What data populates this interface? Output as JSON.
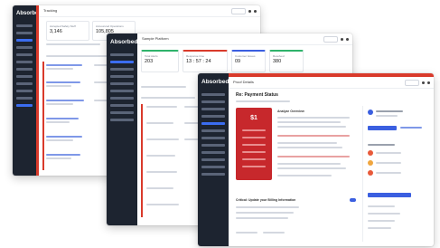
{
  "windows": {
    "back": {
      "title": "Tracking",
      "logo": "Absorbed",
      "cards": [
        {
          "label": "Accepted Safety Stuff",
          "value": "3,146"
        },
        {
          "label": "Announced Operations",
          "value": "105,805"
        }
      ]
    },
    "middle": {
      "title": "Sample Platform",
      "logo": "Absorbed",
      "stats": [
        {
          "label": "Total Alerts",
          "value": "203"
        },
        {
          "label": "Response time",
          "value": "13 : 57 : 24"
        },
        {
          "label": "Customer Issues",
          "value": "09"
        },
        {
          "label": "Resolved",
          "value": "380"
        }
      ]
    },
    "front": {
      "title": "Proof Details",
      "logo": "Absorbed",
      "heading": "Re: Payment Status",
      "panel_value": "$1",
      "section_title": "Analyze Overview",
      "bottom_title": "Critical: Update your Billing Information"
    }
  },
  "colors": {
    "accent": "#3b5fe0",
    "alert": "#d93a2b",
    "sidebar": "#1d2430"
  }
}
